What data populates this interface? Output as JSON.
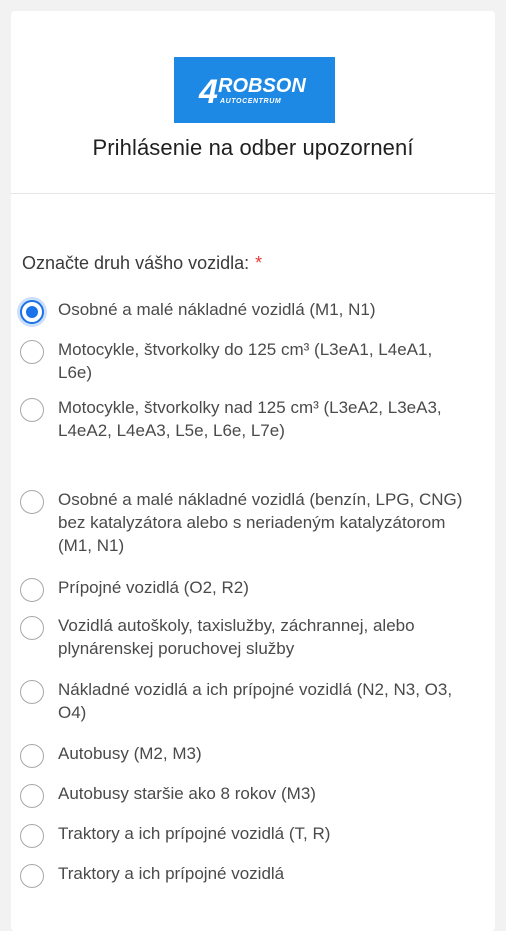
{
  "logo": {
    "brand": "ROBSON",
    "sub": "AUTOCENTRUM",
    "mark": "4",
    "color": "#1e88e5"
  },
  "title": "Prihlásenie na odber upozornení",
  "question": {
    "label": "Označte druh vášho vozidla:",
    "required_mark": "*"
  },
  "accent_color": "#1a73e8",
  "options": [
    {
      "label": "Osobné a malé nákladné vozidlá (M1, N1)",
      "checked": true
    },
    {
      "label": "Motocykle, štvorkolky do 125 cm³ (L3eA1, L4eA1, L6e)",
      "checked": false
    },
    {
      "label": "Motocykle, štvorkolky nad 125 cm³ (L3eA2, L3eA3, L4eA2, L4eA3, L5e, L6e, L7e)",
      "checked": false
    },
    {
      "label": "Osobné a malé nákladné vozidlá (benzín, LPG, CNG) bez katalyzátora alebo s neriadeným katalyzátorom (M1, N1)",
      "checked": false
    },
    {
      "label": "Prípojné vozidlá (O2, R2)",
      "checked": false
    },
    {
      "label": "Vozidlá autoškoly, taxislužby, záchrannej, alebo plynárenskej poruchovej služby",
      "checked": false
    },
    {
      "label": "Nákladné vozidlá a ich prípojné vozidlá (N2, N3, O3, O4)",
      "checked": false
    },
    {
      "label": "Autobusy (M2, M3)",
      "checked": false
    },
    {
      "label": "Autobusy staršie ako 8 rokov (M3)",
      "checked": false
    },
    {
      "label": "Traktory a ich prípojné vozidlá (T, R)",
      "checked": false
    },
    {
      "label": "Traktory a ich prípojné vozidlá",
      "checked": false
    }
  ]
}
